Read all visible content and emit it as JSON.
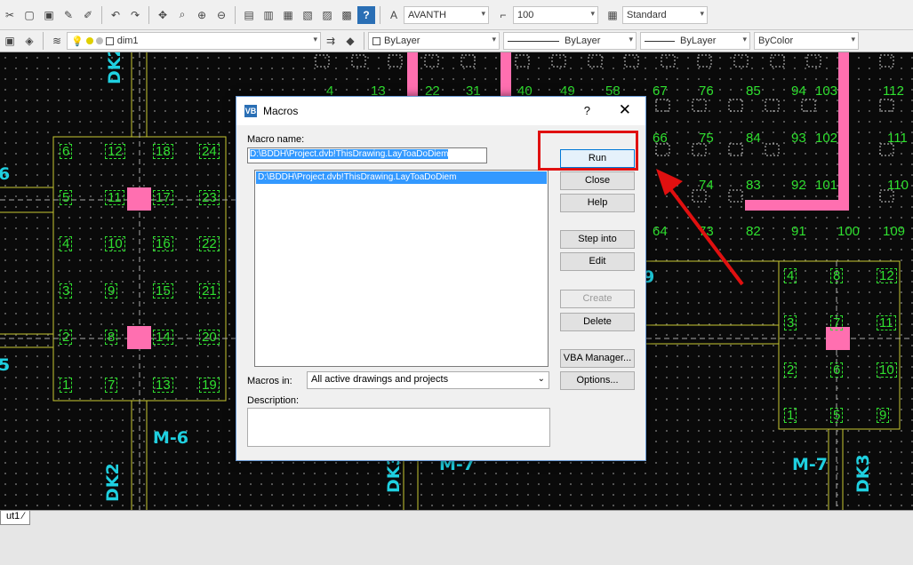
{
  "toolbar1": {
    "text_style": "AVANTH",
    "dim_scale": "100",
    "table_style": "Standard"
  },
  "toolbar2": {
    "layer_name": "dim1",
    "color": "ByLayer",
    "linetype": "ByLayer",
    "lineweight": "ByLayer",
    "plot_style": "ByColor"
  },
  "canvas": {
    "grid_left": {
      "col1": [
        "6",
        "5",
        "4",
        "3",
        "2",
        "1"
      ],
      "col2": [
        "12",
        "11",
        "10",
        "9",
        "8",
        "7"
      ],
      "col3": [
        "18",
        "17",
        "16",
        "15",
        "14",
        "13"
      ],
      "col4": [
        "24",
        "23",
        "22",
        "21",
        "20",
        "19"
      ]
    },
    "grid_top": [
      "4",
      "13",
      "22",
      "31",
      "40",
      "49",
      "58",
      "67",
      "76",
      "85",
      "94",
      "103",
      "112"
    ],
    "grid_row2": [
      "66",
      "75",
      "84",
      "93",
      "102",
      "111"
    ],
    "grid_row3": [
      "74",
      "83",
      "92",
      "101",
      "110"
    ],
    "grid_row4": [
      "64",
      "73",
      "82",
      "91",
      "100",
      "109"
    ],
    "grid_right": {
      "col1": [
        "4",
        "3",
        "2",
        "1"
      ],
      "col2": [
        "8",
        "7",
        "6",
        "5"
      ],
      "col3": [
        "12",
        "11",
        "10",
        "9"
      ]
    },
    "labels": {
      "dk_top": "DK2",
      "dk_bottom_left": "DK2",
      "dk_bottom_mid": "DK3",
      "dk_bottom_right": "DK3",
      "m6": "M-6",
      "m7_mid": "M-7",
      "m7_right": "M-7",
      "edge_left_6": "6",
      "edge_left_5": "5",
      "edge_mid_9": "9"
    },
    "layout_tab": "ut1"
  },
  "dialog": {
    "title": "Macros",
    "help_glyph": "?",
    "close_glyph": "✕",
    "macro_name_label": "Macro name:",
    "macro_name_value": "D:\\BDDH\\Project.dvb!ThisDrawing.LayToaDoDiem",
    "macro_list": [
      "D:\\BDDH\\Project.dvb!ThisDrawing.LayToaDoDiem"
    ],
    "buttons": {
      "run": "Run",
      "close": "Close",
      "help": "Help",
      "step_into": "Step into",
      "edit": "Edit",
      "create": "Create",
      "delete": "Delete",
      "vba_manager": "VBA Manager...",
      "options": "Options..."
    },
    "macros_in_label": "Macros in:",
    "macros_in_value": "All active drawings and projects",
    "description_label": "Description:"
  },
  "colors": {
    "grid_green": "#2fe02f",
    "label_cyan": "#1fd0e0",
    "pink": "#ff6fb0",
    "highlight_red": "#e01010"
  }
}
